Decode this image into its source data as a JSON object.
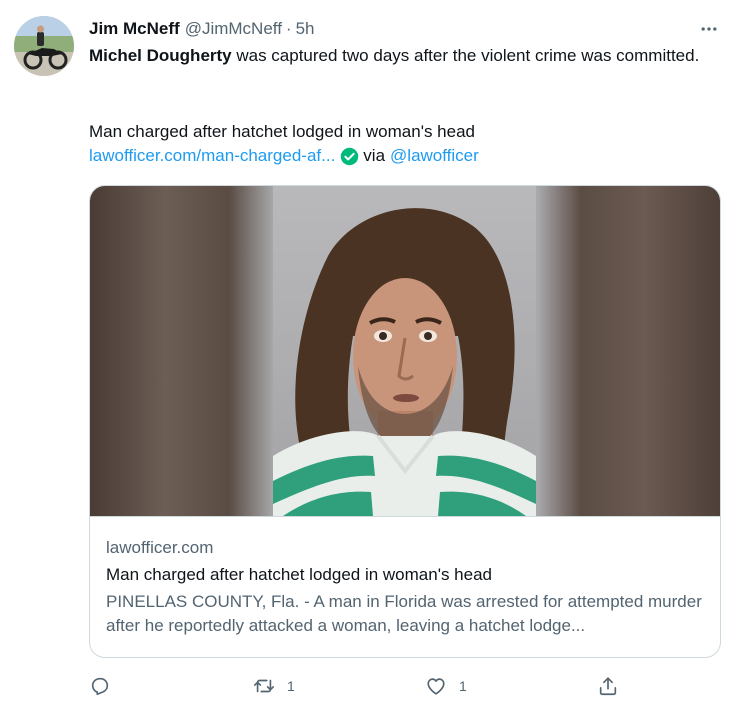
{
  "tweet": {
    "author_name": "Jim McNeff",
    "author_handle": "@JimMcNeff",
    "separator": "·",
    "time": "5h",
    "text_mention": "Michel Dougherty",
    "text_rest": " was captured two days after the violent crime was committed.",
    "headline": "Man charged after hatchet lodged in woman's head",
    "link_text": "lawofficer.com/man-charged-af...",
    "via_label": "via",
    "via_handle": "@lawofficer"
  },
  "card": {
    "domain": "lawofficer.com",
    "title": "Man charged after hatchet lodged in woman's head",
    "description": "PINELLAS COUNTY, Fla. - A man in Florida was arrested for attempted murder after he reportedly attacked a woman, leaving a hatchet lodge..."
  },
  "actions": {
    "reply_count": "",
    "retweet_count": "1",
    "like_count": "1",
    "share_count": ""
  },
  "icons": {
    "avatar": "avatar-motorcycle-image",
    "more": "more-horizontal-icon",
    "verified": "verified-check-icon",
    "reply": "reply-icon",
    "retweet": "retweet-icon",
    "like": "heart-icon",
    "share": "share-icon"
  },
  "colors": {
    "link": "#1d9bf0",
    "verified": "#00ba7c",
    "secondary_text": "#536471",
    "border": "#cfd9de"
  }
}
